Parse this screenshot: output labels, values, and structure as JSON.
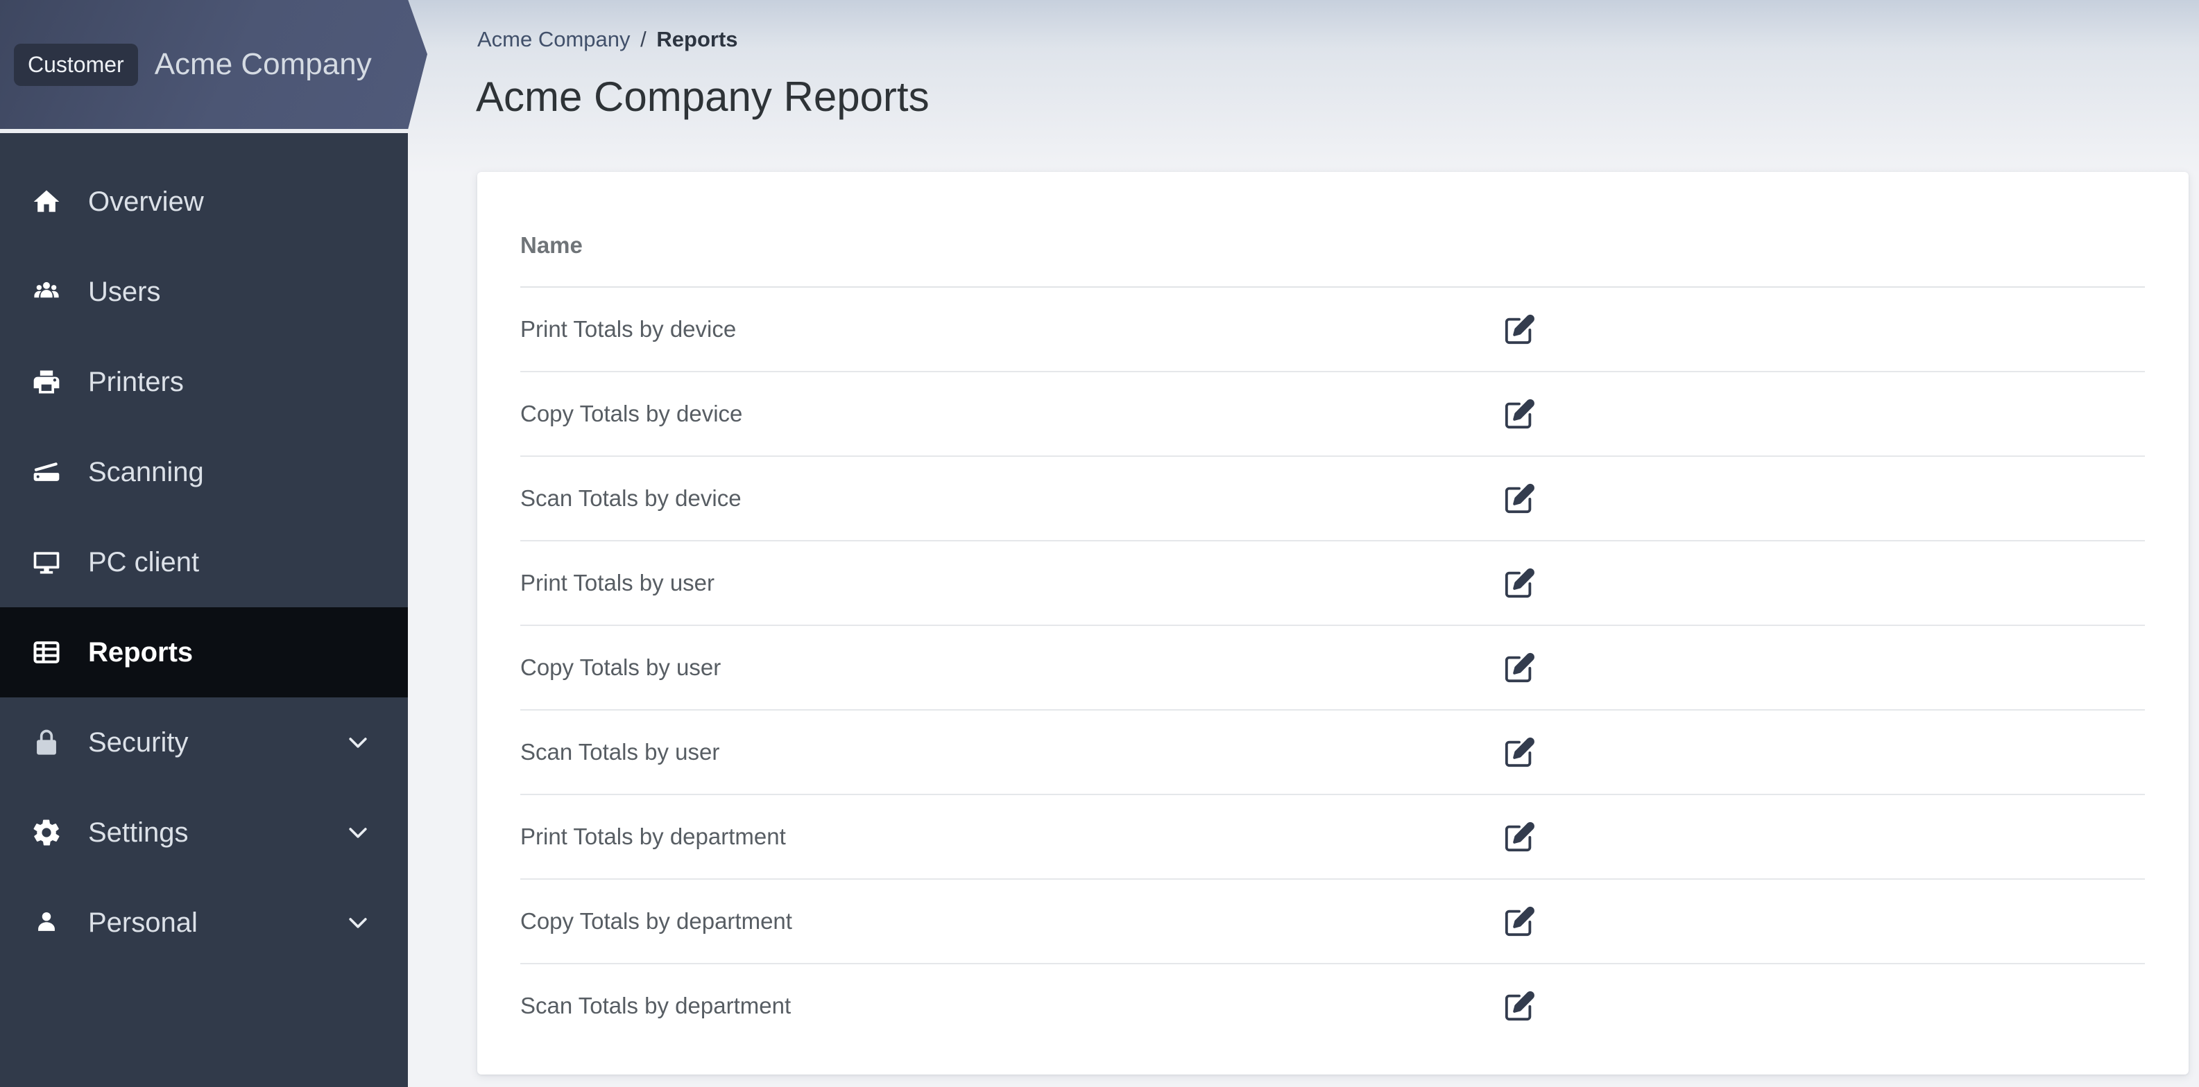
{
  "colors": {
    "sidebar_bg": "#313A4A",
    "sidebar_selected_bg": "#0B0E13",
    "banner_gradient_start": "#3E4760",
    "banner_gradient_end": "#505A7A",
    "badge_bg": "#2C3344",
    "page_bg": "#F2F3F6",
    "card_bg": "#FFFFFF",
    "row_divider": "#E5E7EA",
    "row_text": "#575D63"
  },
  "sidebar": {
    "badge": "Customer",
    "company_name": "Acme Company",
    "items": [
      {
        "label": "Overview",
        "icon": "home-icon",
        "selected": false,
        "chevron": false
      },
      {
        "label": "Users",
        "icon": "users-icon",
        "selected": false,
        "chevron": false
      },
      {
        "label": "Printers",
        "icon": "printer-icon",
        "selected": false,
        "chevron": false
      },
      {
        "label": "Scanning",
        "icon": "scanner-icon",
        "selected": false,
        "chevron": false
      },
      {
        "label": "PC client",
        "icon": "desktop-icon",
        "selected": false,
        "chevron": false
      },
      {
        "label": "Reports",
        "icon": "reports-icon",
        "selected": true,
        "chevron": false
      },
      {
        "label": "Security",
        "icon": "lock-icon",
        "selected": false,
        "chevron": true
      },
      {
        "label": "Settings",
        "icon": "gear-icon",
        "selected": false,
        "chevron": true
      },
      {
        "label": "Personal",
        "icon": "person-icon",
        "selected": false,
        "chevron": true
      }
    ]
  },
  "breadcrumb": {
    "parent": "Acme Company",
    "separator": "/",
    "current": "Reports"
  },
  "page": {
    "title": "Acme Company Reports"
  },
  "table": {
    "columns": [
      "Name"
    ],
    "rows": [
      {
        "name": "Print Totals by device"
      },
      {
        "name": "Copy Totals by device"
      },
      {
        "name": "Scan Totals by device"
      },
      {
        "name": "Print Totals by user"
      },
      {
        "name": "Copy Totals by user"
      },
      {
        "name": "Scan Totals by user"
      },
      {
        "name": "Print Totals by department"
      },
      {
        "name": "Copy Totals by department"
      },
      {
        "name": "Scan Totals by department"
      }
    ],
    "row_action_icon": "edit-icon"
  }
}
